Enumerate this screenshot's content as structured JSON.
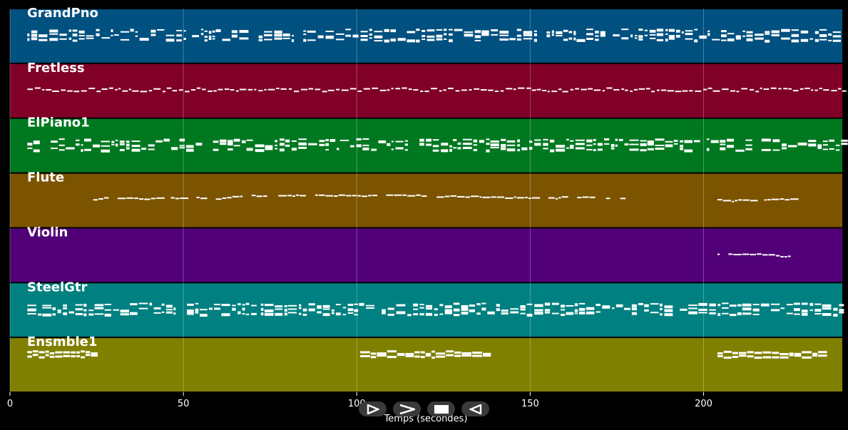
{
  "chart_data": {
    "type": "piano-roll",
    "xlabel": "Temps (secondes)",
    "xlim": [
      0,
      240
    ],
    "xticks": [
      0,
      50,
      100,
      150,
      200
    ],
    "grid": true,
    "tracks": [
      {
        "name": "GrandPno",
        "color": "#005080",
        "segments": [
          [
            5,
            238
          ]
        ],
        "style": "dense"
      },
      {
        "name": "Fretless",
        "color": "#800028",
        "segments": [
          [
            5,
            240
          ]
        ],
        "style": "line"
      },
      {
        "name": "ElPiano1",
        "color": "#007820",
        "segments": [
          [
            5,
            240
          ]
        ],
        "style": "dense"
      },
      {
        "name": "Flute",
        "color": "#7c5400",
        "segments": [
          [
            24,
            177
          ],
          [
            204,
            225
          ]
        ],
        "style": "sparse"
      },
      {
        "name": "Violin",
        "color": "#520078",
        "segments": [
          [
            204,
            225
          ]
        ],
        "style": "sparse"
      },
      {
        "name": "SteelGtr",
        "color": "#008080",
        "segments": [
          [
            5,
            240
          ]
        ],
        "style": "dense"
      },
      {
        "name": "Ensmble1",
        "color": "#808000",
        "segments": [
          [
            5,
            24
          ],
          [
            101,
            137
          ],
          [
            204,
            235
          ]
        ],
        "style": "medium"
      }
    ]
  },
  "controls": [
    {
      "name": "play-button",
      "icon": "play-outline-icon"
    },
    {
      "name": "forward-button",
      "icon": "chevron-right-icon"
    },
    {
      "name": "stop-button",
      "icon": "stop-icon"
    },
    {
      "name": "back-button",
      "icon": "rewind-icon"
    }
  ]
}
